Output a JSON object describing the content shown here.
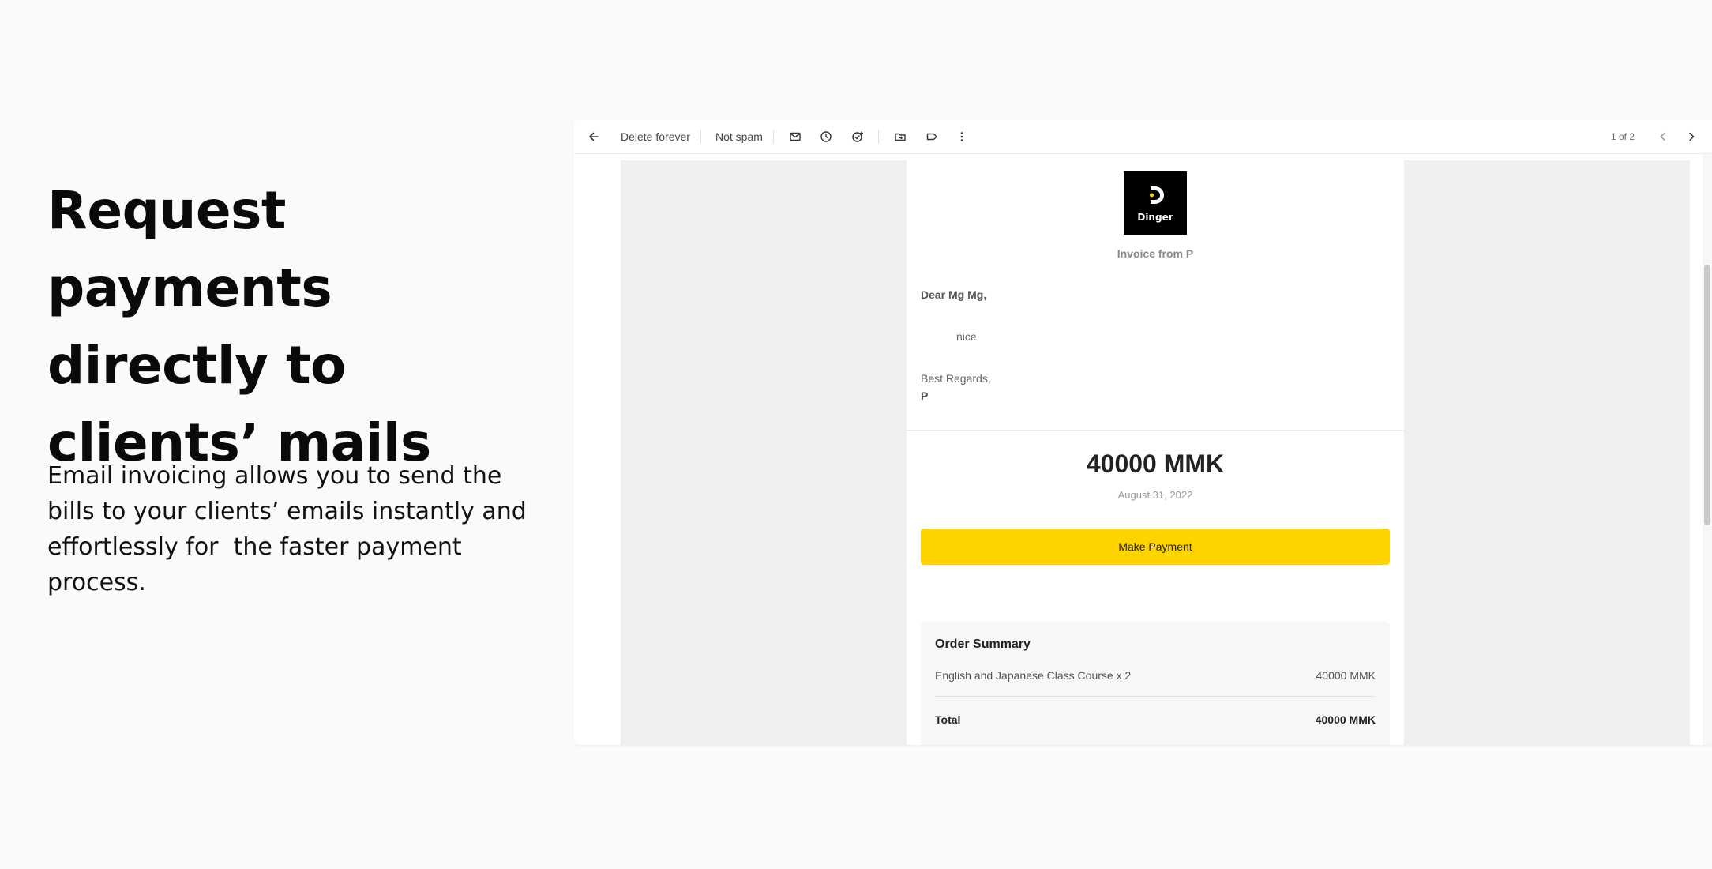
{
  "hero": {
    "title": "Request payments directly to clients’ mails",
    "description": "Email invoicing allows you to send the bills to your clients’ emails instantly and effortlessly for  the faster payment process."
  },
  "toolbar": {
    "back_icon": "arrow-left-icon",
    "delete_forever_label": "Delete forever",
    "not_spam_label": "Not spam",
    "icons": [
      "mark-unread-icon",
      "snooze-icon",
      "add-task-icon",
      "move-to-icon",
      "label-icon",
      "more-vert-icon"
    ],
    "pager_text": "1 of 2",
    "prev_icon": "chevron-left-icon",
    "next_icon": "chevron-right-icon"
  },
  "invoice": {
    "logo_text": "Dinger",
    "invoice_from": "Invoice from P",
    "greeting": "Dear Mg Mg,",
    "message": "nice",
    "signoff": "Best Regards,",
    "signer": "P",
    "amount": "40000 MMK",
    "date": "August 31, 2022",
    "pay_button_label": "Make Payment",
    "colors": {
      "pay_button": "#ffd300",
      "logo_bg": "#000000"
    }
  },
  "summary": {
    "title": "Order Summary",
    "items": [
      {
        "name": "English and Japanese Class Course x 2",
        "price": "40000 MMK"
      }
    ],
    "total_label": "Total",
    "total_value": "40000 MMK"
  }
}
